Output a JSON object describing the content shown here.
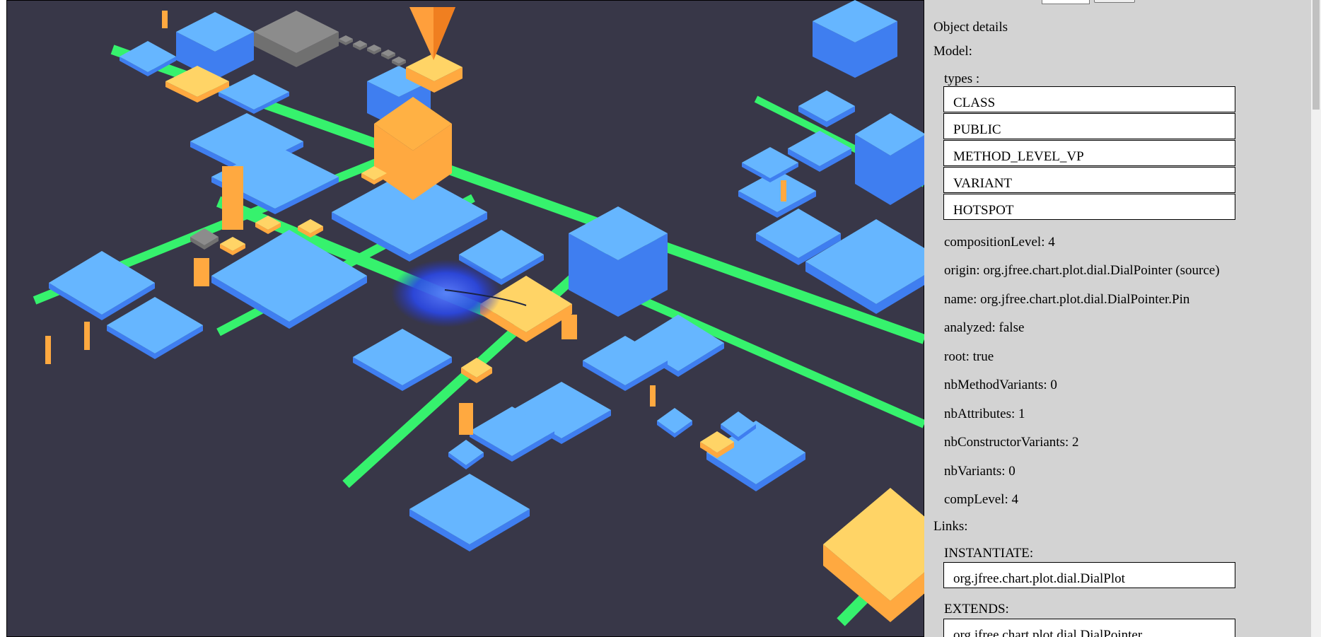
{
  "details": {
    "title": "Object details",
    "model_label": "Model:",
    "types_label": "types :",
    "types": [
      "CLASS",
      "PUBLIC",
      "METHOD_LEVEL_VP",
      "VARIANT",
      "HOTSPOT"
    ],
    "properties": [
      "compositionLevel: 4",
      "origin: org.jfree.chart.plot.dial.DialPointer (source)",
      "name: org.jfree.chart.plot.dial.DialPointer.Pin",
      "analyzed: false",
      "root: true",
      "nbMethodVariants: 0",
      "nbAttributes: 1",
      "nbConstructorVariants: 2",
      "nbVariants: 0",
      "compLevel: 4"
    ],
    "links_label": "Links:",
    "links": [
      {
        "type": "INSTANTIATE:",
        "target": "org.jfree.chart.plot.dial.DialPlot"
      },
      {
        "type": "EXTENDS:",
        "target": "org.jfree.chart.plot.dial.DialPointer"
      }
    ]
  },
  "colors": {
    "ground": "#383748",
    "road": "#36f26d",
    "class_block": "#66b6ff",
    "class_block_side": "#3f7ef0",
    "hotspot_block": "#ffd466",
    "hotspot_side": "#ffa940",
    "selection": "#1f3be0",
    "sidebar": "#d3d3d3"
  }
}
